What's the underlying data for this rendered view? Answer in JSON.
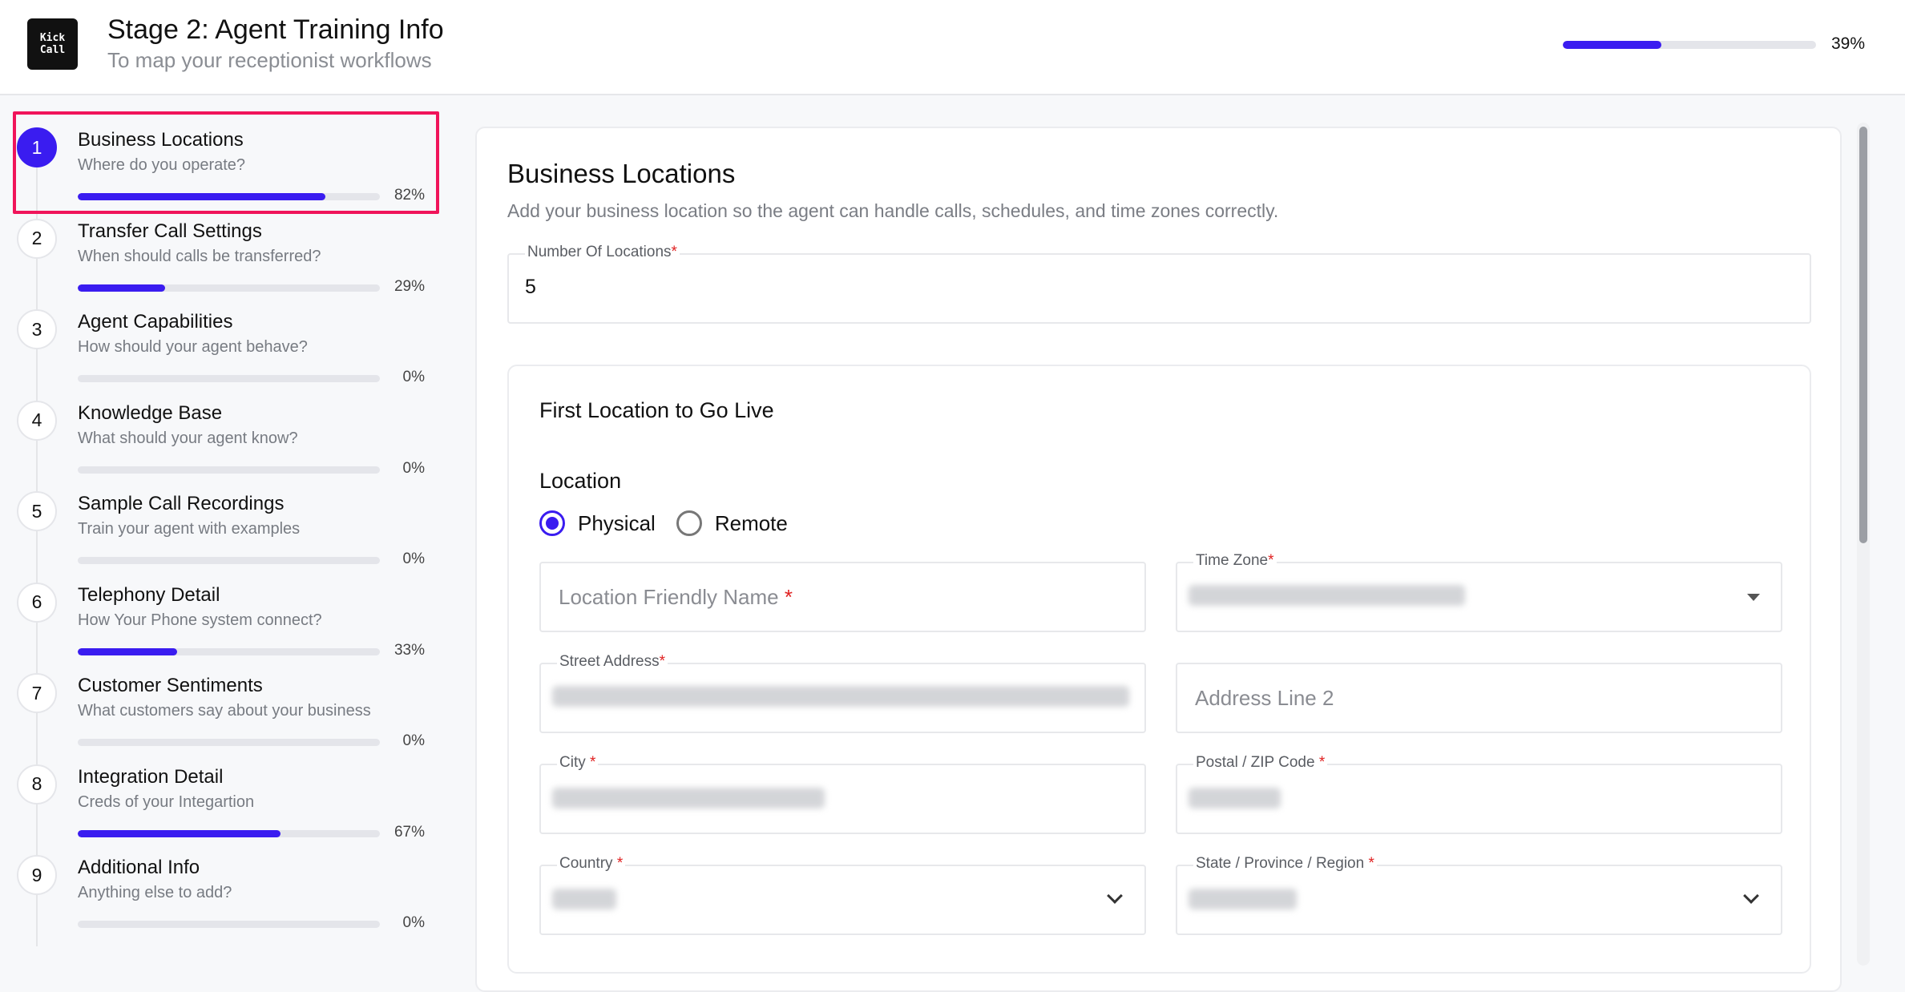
{
  "header": {
    "logo_line1": "Kick",
    "logo_line2": "Call",
    "title": "Stage 2: Agent Training Info",
    "subtitle": "To map your receptionist workflows",
    "progress_label": "39%",
    "progress_value": 0.39
  },
  "steps": [
    {
      "num": "1",
      "title": "Business Locations",
      "desc": "Where do you operate?",
      "pct": "82%",
      "value": 0.82,
      "active": true
    },
    {
      "num": "2",
      "title": "Transfer Call Settings",
      "desc": "When should calls be transferred?",
      "pct": "29%",
      "value": 0.29
    },
    {
      "num": "3",
      "title": "Agent Capabilities",
      "desc": "How should your agent behave?",
      "pct": "0%",
      "value": 0
    },
    {
      "num": "4",
      "title": "Knowledge Base",
      "desc": "What should your agent know?",
      "pct": "0%",
      "value": 0
    },
    {
      "num": "5",
      "title": "Sample Call Recordings",
      "desc": "Train your agent with examples",
      "pct": "0%",
      "value": 0
    },
    {
      "num": "6",
      "title": "Telephony Detail",
      "desc": "How Your Phone system connect?",
      "pct": "33%",
      "value": 0.33
    },
    {
      "num": "7",
      "title": "Customer Sentiments",
      "desc": "What customers say about your business",
      "pct": "0%",
      "value": 0
    },
    {
      "num": "8",
      "title": "Integration Detail",
      "desc": "Creds of your Integartion",
      "pct": "67%",
      "value": 0.67
    },
    {
      "num": "9",
      "title": "Additional Info",
      "desc": "Anything else to add?",
      "pct": "0%",
      "value": 0
    }
  ],
  "main": {
    "title": "Business Locations",
    "description": "Add your business location so the agent can handle calls, schedules, and time zones correctly.",
    "num_locations_label": "Number Of Locations",
    "num_locations_value": "5",
    "required_mark": "*",
    "first_location_title": "First Location to Go Live",
    "location_heading": "Location",
    "radio_physical": "Physical",
    "radio_remote": "Remote",
    "friendly_name_placeholder": "Location Friendly Name",
    "time_zone_label": "Time Zone",
    "street_address_label": "Street Address",
    "address_line2_placeholder": "Address Line 2",
    "city_label": "City",
    "postal_label": "Postal / ZIP Code",
    "country_label": "Country",
    "state_label": "State / Province / Region"
  },
  "colors": {
    "accent": "#3a1cf0",
    "highlight": "#f0145a",
    "required": "#e02020"
  }
}
